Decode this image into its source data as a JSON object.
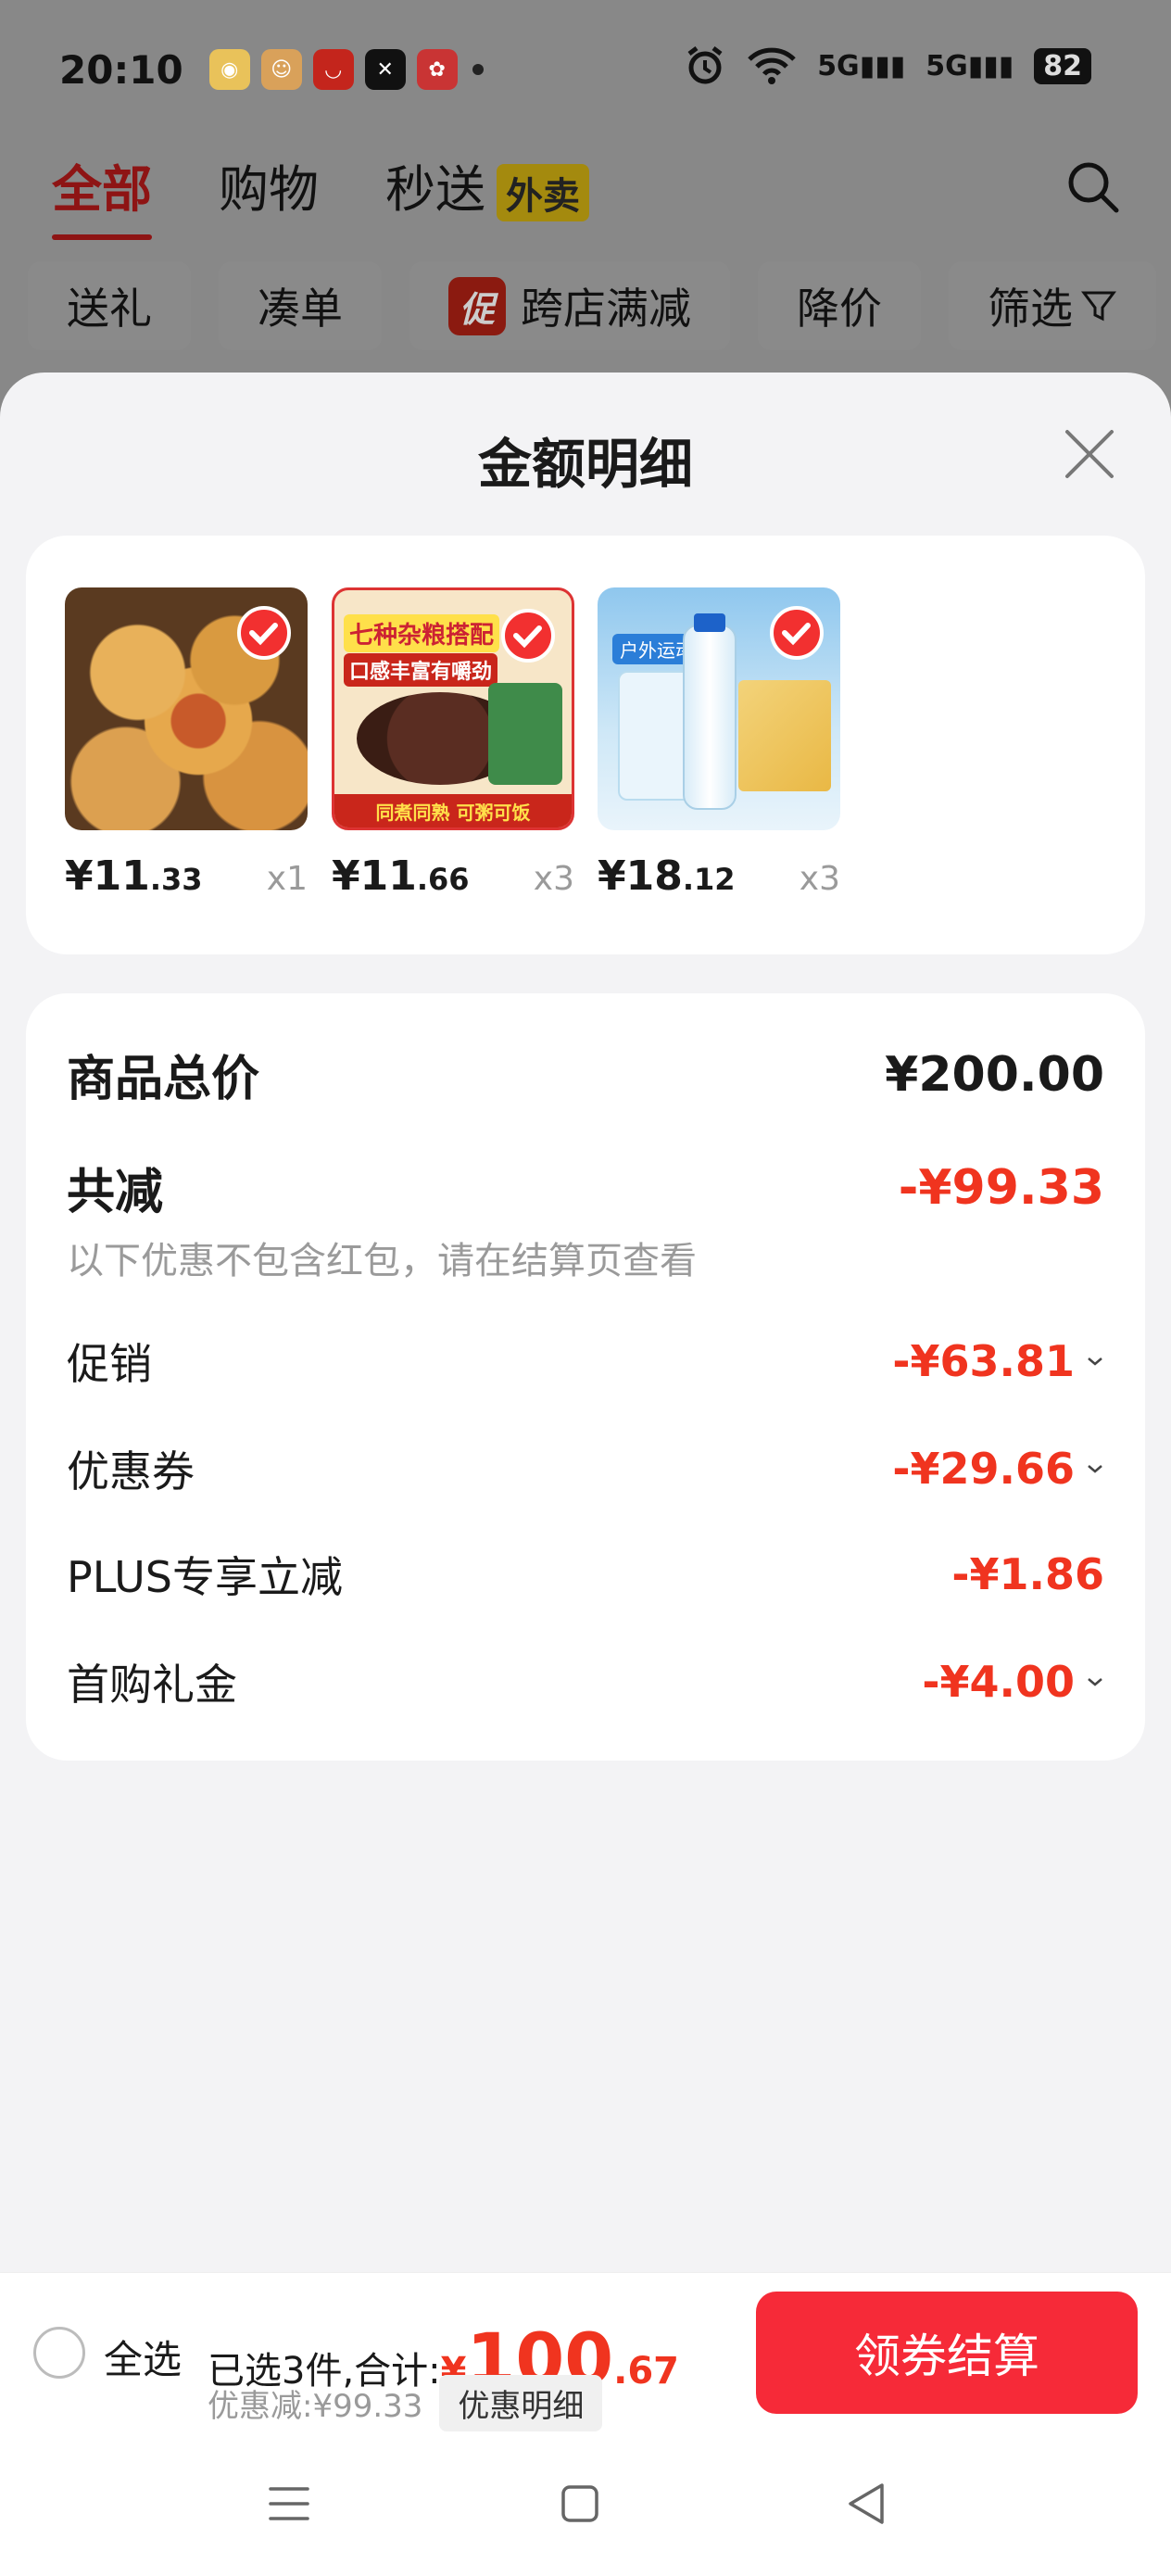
{
  "status_bar": {
    "time": "20:10",
    "app_icons": [
      "weibo-app-icon",
      "618-app-icon",
      "smile-app-icon",
      "capcut-app-icon",
      "flower-app-icon"
    ],
    "signal_1": "5G",
    "signal_2": "5G",
    "battery": "82"
  },
  "top_tabs": [
    {
      "label": "全部",
      "active": true
    },
    {
      "label": "购物",
      "active": false
    },
    {
      "label": "秒送",
      "active": false
    }
  ],
  "takeout_tag": "外卖",
  "chips": [
    "送礼",
    "凑单",
    "跨店满减",
    "降价",
    "筛选"
  ],
  "promo_badge": "促",
  "sheet": {
    "title": "金额明细",
    "products": [
      {
        "price_int": "¥11",
        "price_dec": ".33",
        "qty": "x1"
      },
      {
        "price_int": "¥11",
        "price_dec": ".66",
        "qty": "x3"
      },
      {
        "price_int": "¥18",
        "price_dec": ".12",
        "qty": "x3"
      }
    ],
    "product2_banner": "七种杂粮搭配",
    "product2_sub": "口感丰富有嚼劲",
    "product2_bottom": "同煮同熟 可粥可饭",
    "product3_tag": "户外运动",
    "summary": {
      "total_label": "商品总价",
      "total_value": "¥200.00",
      "reduce_label": "共减",
      "reduce_value": "-¥99.33",
      "note": "以下优惠不包含红包，请在结算页查看",
      "items": [
        {
          "label": "促销",
          "value": "-¥63.81",
          "expandable": true
        },
        {
          "label": "优惠券",
          "value": "-¥29.66",
          "expandable": true
        },
        {
          "label": "PLUS专享立减",
          "value": "-¥1.86",
          "expandable": false
        },
        {
          "label": "首购礼金",
          "value": "-¥4.00",
          "expandable": true
        }
      ]
    }
  },
  "action_bar": {
    "select_all": "全选",
    "selected_text": "已选3件,合计:",
    "amount_currency": "¥",
    "amount_int": "100",
    "amount_dec": ".67",
    "discount_text": "优惠减:¥99.33",
    "detail_button": "优惠明细",
    "checkout_button": "领券结算"
  },
  "colors": {
    "accent_red": "#f0341f",
    "checkout_red": "#f62a38",
    "sheet_bg": "#f3f3f5"
  }
}
